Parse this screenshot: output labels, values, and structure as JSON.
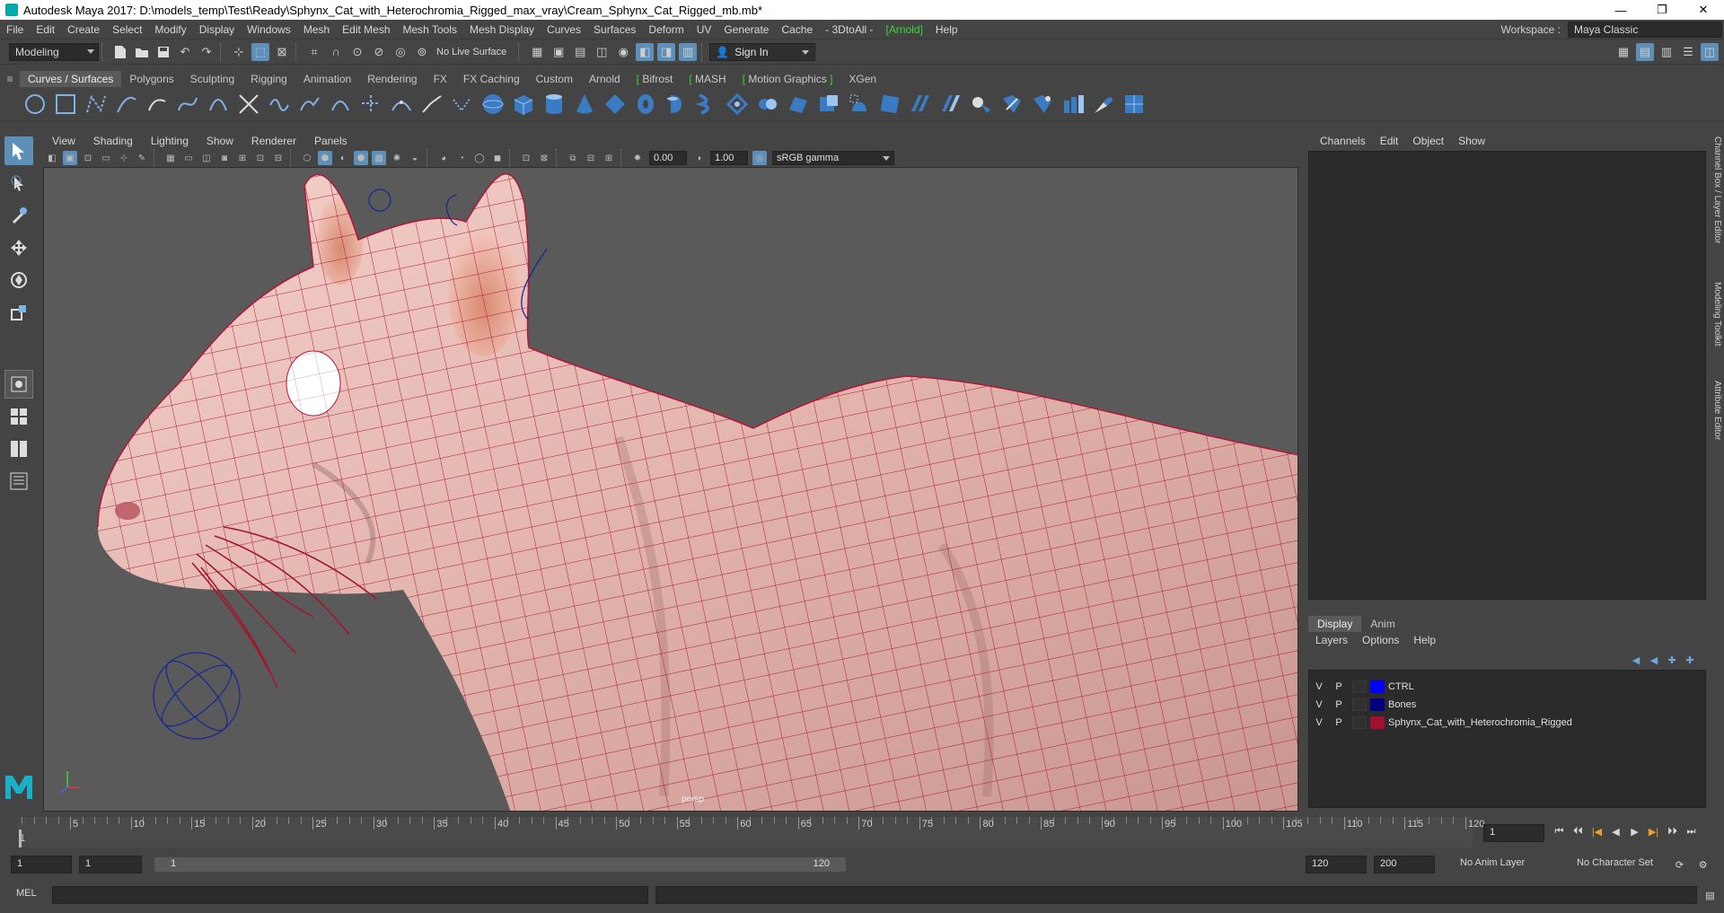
{
  "window": {
    "title": "Autodesk Maya 2017: D:\\models_temp\\Test\\Ready\\Sphynx_Cat_with_Heterochromia_Rigged_max_vray\\Cream_Sphynx_Cat_Rigged_mb.mb*",
    "minimize": "—",
    "maximize": "❐",
    "close": "✕"
  },
  "menubar": {
    "items": [
      "File",
      "Edit",
      "Create",
      "Select",
      "Modify",
      "Display",
      "Windows",
      "Mesh",
      "Edit Mesh",
      "Mesh Tools",
      "Mesh Display",
      "Curves",
      "Surfaces",
      "Deform",
      "UV",
      "Generate",
      "Cache",
      "- 3DtoAll -",
      "[Arnold]",
      "Help"
    ],
    "workspace_label": "Workspace :",
    "workspace_value": "Maya Classic"
  },
  "statusline": {
    "menuset": "Modeling",
    "live_surface": "No Live Surface",
    "sign_in": "Sign In"
  },
  "shelf": {
    "tabs": [
      "Curves / Surfaces",
      "Polygons",
      "Sculpting",
      "Rigging",
      "Animation",
      "Rendering",
      "FX",
      "FX Caching",
      "Custom",
      "Arnold",
      "Bifrost",
      "MASH",
      "Motion Graphics",
      "XGen"
    ],
    "active_tab": "Curves / Surfaces"
  },
  "viewport": {
    "menu": [
      "View",
      "Shading",
      "Lighting",
      "Show",
      "Renderer",
      "Panels"
    ],
    "exposure": "0.00",
    "gamma": "1.00",
    "color_space": "sRGB gamma",
    "camera": "persp"
  },
  "channel_box": {
    "menu": [
      "Channels",
      "Edit",
      "Object",
      "Show"
    ]
  },
  "layer_editor": {
    "tabs": [
      "Display",
      "Anim"
    ],
    "active_tab": "Display",
    "menu": [
      "Layers",
      "Options",
      "Help"
    ],
    "layers": [
      {
        "v": "V",
        "p": "P",
        "color": "#0000ff",
        "name": "CTRL"
      },
      {
        "v": "V",
        "p": "P",
        "color": "#000080",
        "name": "Bones"
      },
      {
        "v": "V",
        "p": "P",
        "color": "#a01030",
        "name": "Sphynx_Cat_with_Heterochromia_Rigged"
      }
    ]
  },
  "side_tabs": [
    "Channel Box / Layer Editor",
    "Modeling Toolkit",
    "Attribute Editor"
  ],
  "timeslider": {
    "labels": [
      "5",
      "10",
      "15",
      "20",
      "25",
      "30",
      "35",
      "40",
      "45",
      "50",
      "55",
      "60",
      "65",
      "70",
      "75",
      "80",
      "85",
      "90",
      "95",
      "100",
      "105",
      "110",
      "115",
      "120"
    ],
    "first_label": "1",
    "current_frame": "1"
  },
  "range": {
    "anim_start": "1",
    "playback_start": "1",
    "slider_start": "1",
    "slider_end": "120",
    "playback_end": "120",
    "anim_end": "200",
    "anim_layer": "No Anim Layer",
    "character_set": "No Character Set"
  },
  "cmdline": {
    "language": "MEL"
  }
}
